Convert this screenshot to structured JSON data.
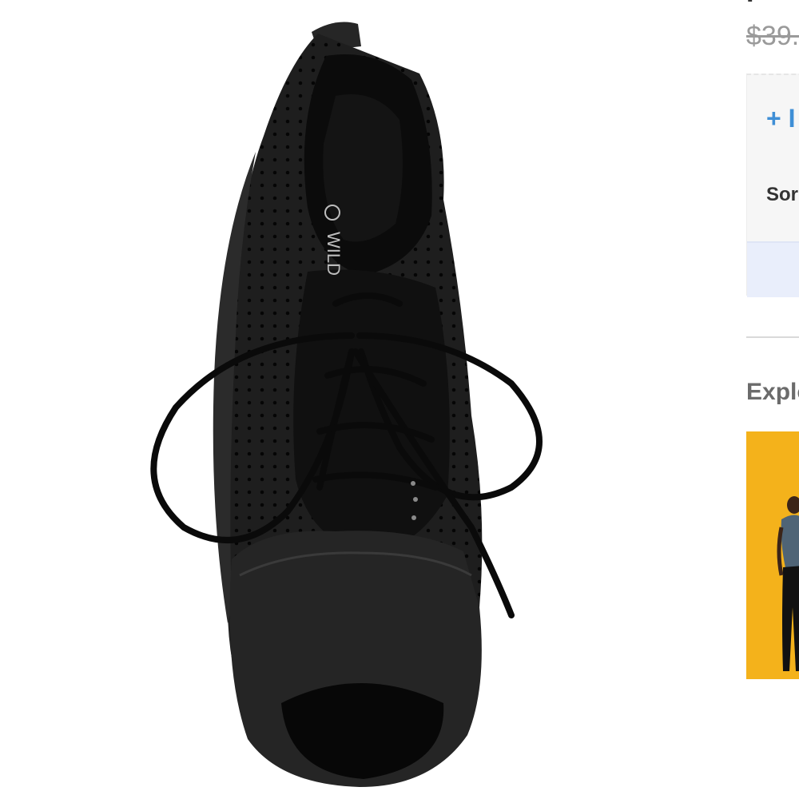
{
  "product": {
    "title": "F",
    "old_price": "$39.",
    "image_brand_text": "WILD"
  },
  "options": {
    "add_label": "+ I",
    "sort_label": "Sor"
  },
  "explore": {
    "heading": "Explo"
  },
  "colors": {
    "link": "#3f8fd6",
    "explore_background": "#f4b21b",
    "shoe": "#1c1c1c"
  }
}
